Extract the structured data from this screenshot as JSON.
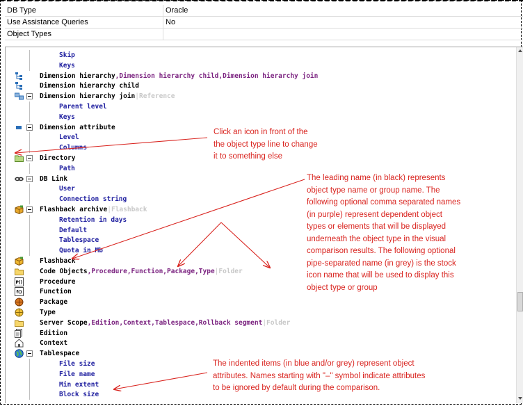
{
  "props": [
    {
      "name": "DB Type",
      "value": "Oracle"
    },
    {
      "name": "Use Assistance Queries",
      "value": "No"
    },
    {
      "name": "Object Types",
      "value": ""
    }
  ],
  "tree": {
    "rows": [
      {
        "kind": "attr",
        "text": "Skip"
      },
      {
        "kind": "attr",
        "text": "Keys"
      },
      {
        "kind": "type",
        "icon": "hierarchy-icon",
        "name": "Dimension hierarchy",
        "deps": "Dimension hierarchy child,Dimension hierarchy join"
      },
      {
        "kind": "type",
        "icon": "hierarchy-icon",
        "name": "Dimension hierarchy child"
      },
      {
        "kind": "type",
        "icon": "hierarchy-join-icon",
        "expander": true,
        "name": "Dimension hierarchy join",
        "stock": "Reference"
      },
      {
        "kind": "attr",
        "text": "Parent level"
      },
      {
        "kind": "attr",
        "text": "Keys"
      },
      {
        "kind": "type",
        "icon": "attribute-icon",
        "expander": true,
        "name": "Dimension attribute"
      },
      {
        "kind": "attr",
        "text": "Level"
      },
      {
        "kind": "attr",
        "text": "Columns"
      },
      {
        "kind": "type",
        "icon": "directory-icon",
        "expander": true,
        "name": "Directory"
      },
      {
        "kind": "attr",
        "text": "Path"
      },
      {
        "kind": "type",
        "icon": "db-link-icon",
        "expander": true,
        "name": "DB Link"
      },
      {
        "kind": "attr",
        "text": "User"
      },
      {
        "kind": "attr",
        "text": "Connection string"
      },
      {
        "kind": "type",
        "icon": "flashback-archive-icon",
        "expander": true,
        "name": "Flashback archive",
        "stock": "Flashback"
      },
      {
        "kind": "attr",
        "text": "Retention in days"
      },
      {
        "kind": "attr",
        "text": "Default"
      },
      {
        "kind": "attr",
        "text": "Tablespace"
      },
      {
        "kind": "attr",
        "text": "Quota in Mb"
      },
      {
        "kind": "type",
        "icon": "flashback-icon",
        "name": "Flashback"
      },
      {
        "kind": "type",
        "icon": "folder-icon",
        "name": "Code Objects",
        "deps": "Procedure,Function,Package,Type",
        "stock": "Folder"
      },
      {
        "kind": "type",
        "icon": "procedure-icon",
        "name": "Procedure"
      },
      {
        "kind": "type",
        "icon": "function-icon",
        "name": "Function"
      },
      {
        "kind": "type",
        "icon": "package-icon",
        "name": "Package"
      },
      {
        "kind": "type",
        "icon": "type-icon",
        "name": "Type"
      },
      {
        "kind": "type",
        "icon": "folder-icon",
        "name": "Server Scope",
        "deps": "Edition,Context,Tablespace,Rollback segment",
        "stock": "Folder"
      },
      {
        "kind": "type",
        "icon": "edition-icon",
        "name": "Edition"
      },
      {
        "kind": "type",
        "icon": "context-icon",
        "name": "Context"
      },
      {
        "kind": "type",
        "icon": "tablespace-icon",
        "expander": true,
        "name": "Tablespace"
      },
      {
        "kind": "attr",
        "text": "File size"
      },
      {
        "kind": "attr",
        "text": "File name"
      },
      {
        "kind": "attr",
        "text": "Min extent"
      },
      {
        "kind": "attr",
        "text": "Block size"
      }
    ]
  },
  "annotations": {
    "icon_note": [
      "Click an icon in front of the",
      "the object type line to change",
      "it to something else"
    ],
    "name_note": [
      "The leading name (in black) represents",
      "object type name or group name. The",
      "following optional comma separated  names",
      "(in purple) represent dependent object",
      "types or elements that will be displayed",
      "underneath the object type in the visual",
      "comparison results. The following optional",
      "pipe-separated name (in grey) is the stock",
      "icon name that will be used to display this",
      "object type or group"
    ],
    "attr_note": [
      "The indented items (in blue and/or grey) represent object",
      "attributes. Names starting with \"–\" symbol indicate attributes",
      "to be ignored by default during the comparison."
    ]
  },
  "colors": {
    "name": "#000000",
    "dependent": "#7b2380",
    "attribute": "#2020a0",
    "stock_icon": "#c8c8c8",
    "annotation": "#d9241f"
  }
}
